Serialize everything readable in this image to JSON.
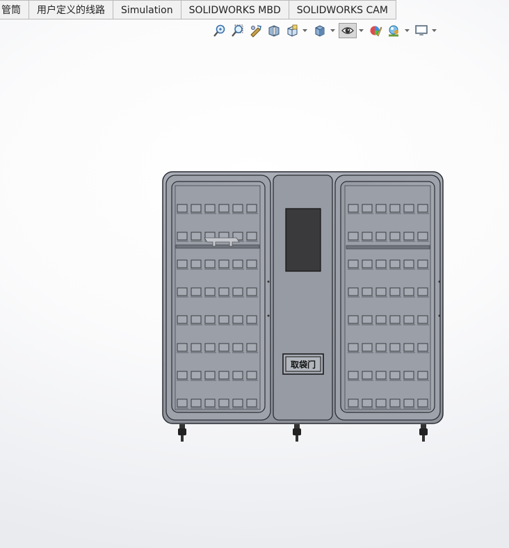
{
  "tabs": [
    {
      "label": "管筒"
    },
    {
      "label": "用户定义的线路"
    },
    {
      "label": "Simulation"
    },
    {
      "label": "SOLIDWORKS MBD"
    },
    {
      "label": "SOLIDWORKS CAM"
    }
  ],
  "toolbar": {
    "buttons": [
      {
        "icon": "zoom-to-fit-icon"
      },
      {
        "icon": "zoom-to-area-icon"
      },
      {
        "icon": "previous-view-icon"
      },
      {
        "icon": "section-view-icon"
      },
      {
        "icon": "view-orientation-icon"
      },
      {
        "icon": "display-style-icon"
      },
      {
        "icon": "hide-show-items-icon"
      },
      {
        "icon": "edit-appearance-icon"
      },
      {
        "icon": "apply-scene-icon"
      },
      {
        "icon": "view-settings-icon"
      }
    ]
  },
  "model": {
    "door_label": "取袋门"
  }
}
